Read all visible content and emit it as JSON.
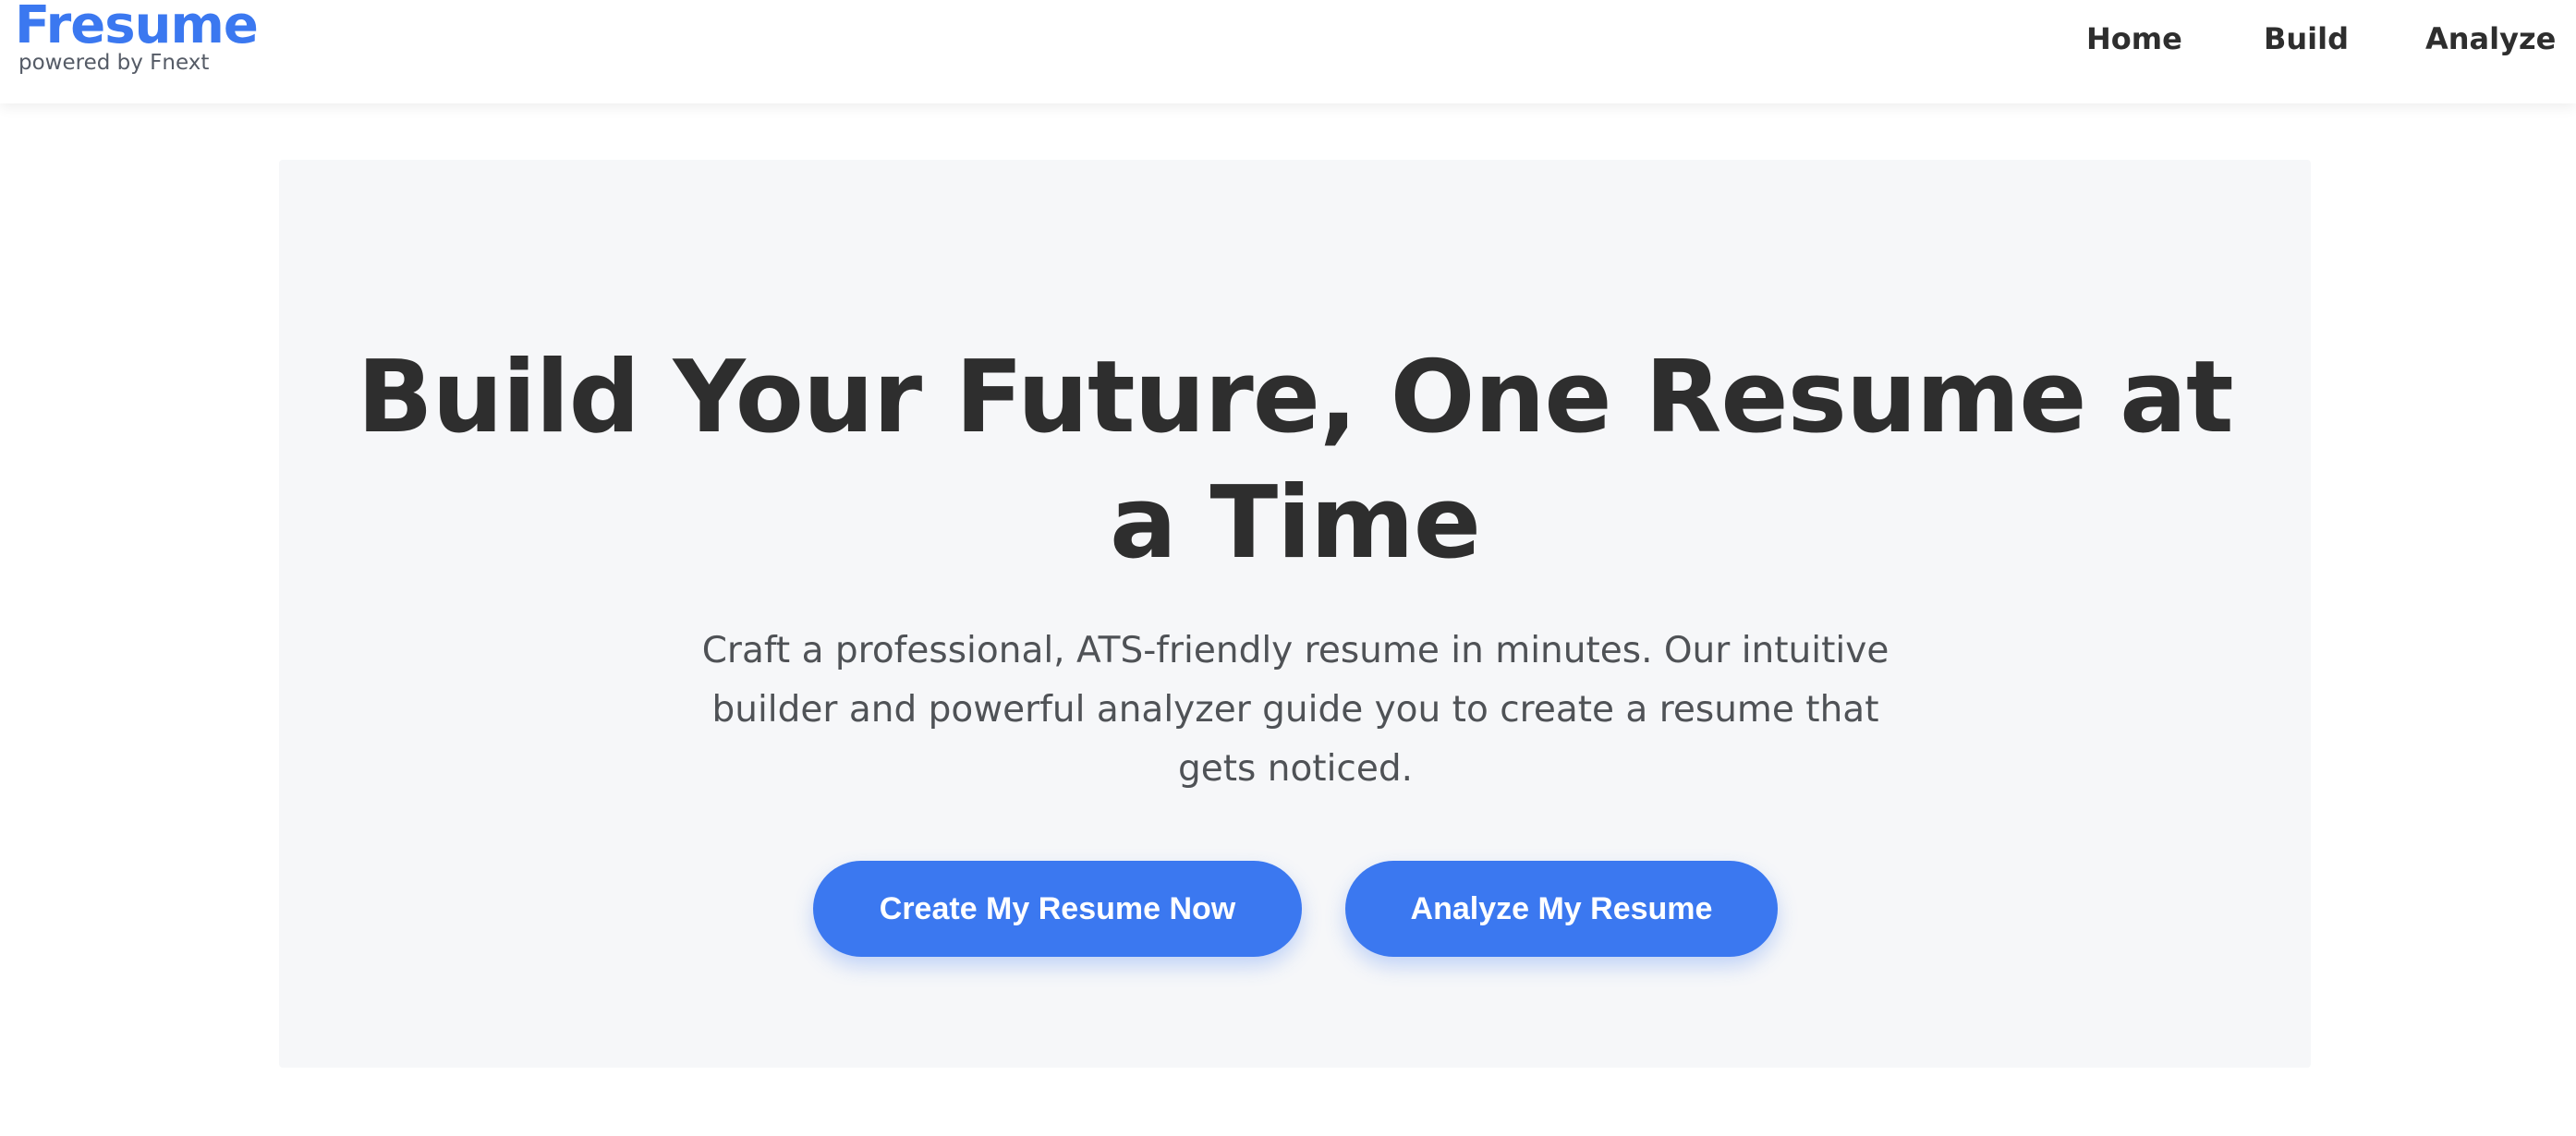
{
  "brand": {
    "name": "Fresume",
    "tagline": "powered by Fnext",
    "color": "#3b78f0"
  },
  "nav": {
    "items": [
      {
        "label": "Home"
      },
      {
        "label": "Build"
      },
      {
        "label": "Analyze"
      }
    ]
  },
  "hero": {
    "title": "Build Your Future, One Resume at a Time",
    "description": "Craft a professional, ATS-friendly resume in minutes. Our intuitive builder and powerful analyzer guide you to create a resume that gets noticed.",
    "primary_button": "Create My Resume Now",
    "secondary_button": "Analyze My Resume",
    "background": "#f6f7f9"
  },
  "colors": {
    "accent": "#3b78f0",
    "heading_text": "#2e2e2e",
    "body_text": "#4f5256"
  }
}
